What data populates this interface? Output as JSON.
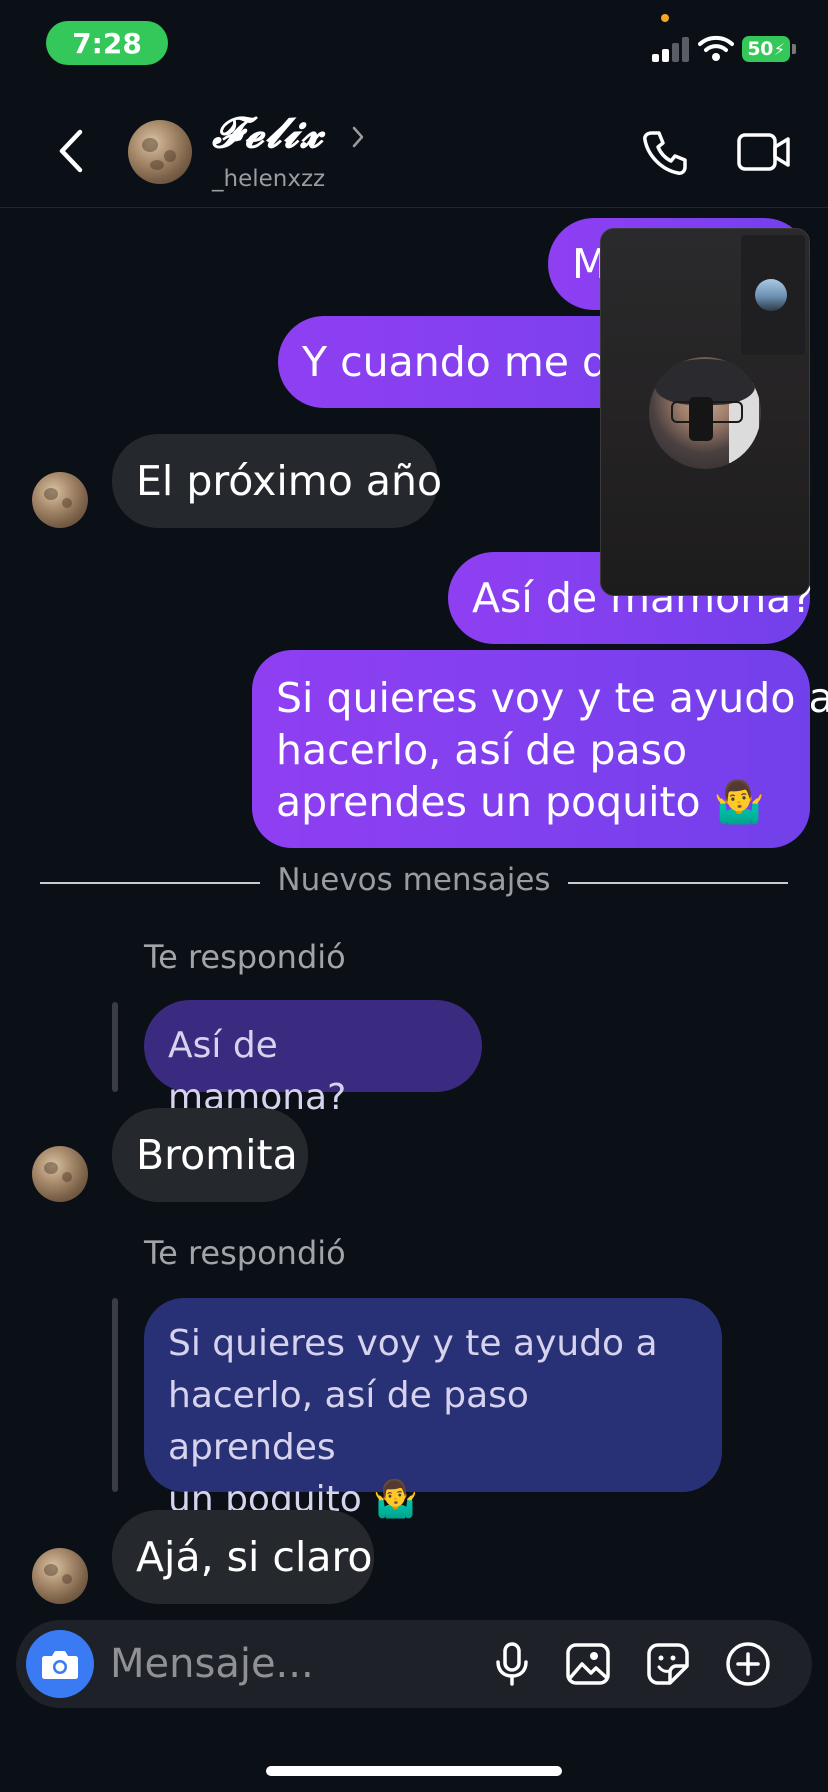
{
  "status_bar": {
    "time": "7:28",
    "battery": "50"
  },
  "header": {
    "name": "𝓕𝓮𝓵𝓲𝔁",
    "username": "_helenxzz"
  },
  "messages": [
    {
      "from": "me",
      "text": "M"
    },
    {
      "from": "me",
      "text": "Y cuando me da"
    },
    {
      "from": "them",
      "text": "El próximo año"
    },
    {
      "from": "me",
      "text": "Así de mamona?"
    },
    {
      "from": "me",
      "lines": [
        "Si quieres voy y te ayudo a",
        "hacerlo, así de paso",
        "aprendes un poquito 🤷‍♂️"
      ]
    },
    {
      "divider": "Nuevos mensajes"
    },
    {
      "replied_label": "Te respondió",
      "quote": "Así de mamona?"
    },
    {
      "from": "them",
      "text": "Bromita"
    },
    {
      "replied_label": "Te respondió",
      "quote_lines": [
        "Si quieres voy y te ayudo a",
        "hacerlo, así de paso aprendes",
        "un poquito 🤷‍♂️"
      ]
    },
    {
      "from": "them",
      "text": "Ajá, si claro"
    }
  ],
  "composer": {
    "placeholder": "Mensaje..."
  },
  "colors": {
    "outgoing": "#8f3ff2",
    "incoming": "#25282d",
    "camera": "#3a7bf4",
    "status_green": "#34c759"
  },
  "icons": [
    "chevron-left-icon",
    "chevron-right-icon",
    "phone-icon",
    "video-icon",
    "camera-icon",
    "microphone-icon",
    "image-icon",
    "sticker-icon",
    "plus-icon"
  ]
}
